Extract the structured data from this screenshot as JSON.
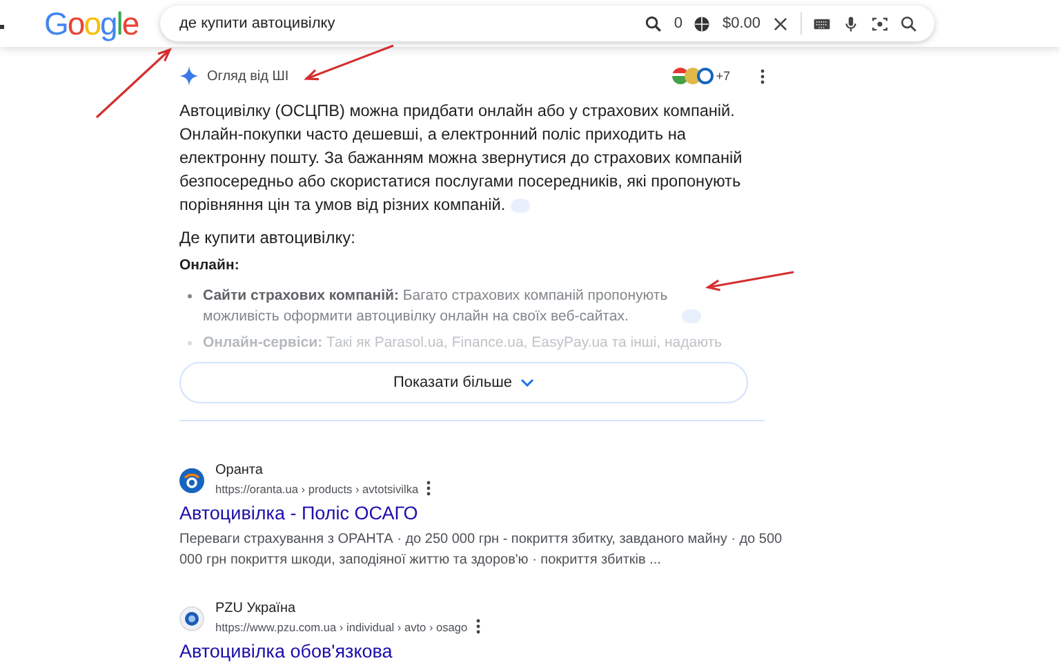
{
  "header": {
    "logo": "Google",
    "query": "де купити автоцивілку",
    "counter": "0",
    "price": "$0.00"
  },
  "ai_overview": {
    "title": "Огляд від ШІ",
    "sources_more": "+7",
    "paragraph": "Автоцивілку (ОСЦПВ) можна придбати онлайн або у страхових компаній. Онлайн-покупки часто дешевші, а електронний поліс приходить на електронну пошту. За бажанням можна звернутися до страхових компаній безпосередньо або скористатися послугами посередників, які пропонують порівняння цін та умов від різних компаній.",
    "subheading": "Де купити автоцивілку:",
    "section": "Онлайн:",
    "bullets": [
      {
        "term": "Сайти страхових компаній:",
        "text": "Багато страхових компаній пропонують можливість оформити автоцивілку онлайн на своїх веб-сайтах.",
        "faded": false,
        "citation": true
      },
      {
        "term": "Онлайн-сервіси:",
        "text": "Такі як Parasol.ua, Finance.ua, EasyPay.ua та інші, надають",
        "faded": true,
        "citation": false
      }
    ],
    "show_more": "Показати більше"
  },
  "results": [
    {
      "site": "Оранта",
      "url": "https://oranta.ua › products › avtotsivilka",
      "title": "Автоцивілка - Поліс ОСАГО",
      "snippet": "Переваги страхування з ОРАНТА · до 250 000 грн - покриття збитку, завданого майну · до 500 000 грн покриття шкоди, заподіяної життю та здоров'ю · покриття збитків ..."
    },
    {
      "site": "PZU Україна",
      "url": "https://www.pzu.com.ua › individual › avto › osago",
      "title": "Автоцивілка обов'язкова"
    }
  ]
}
